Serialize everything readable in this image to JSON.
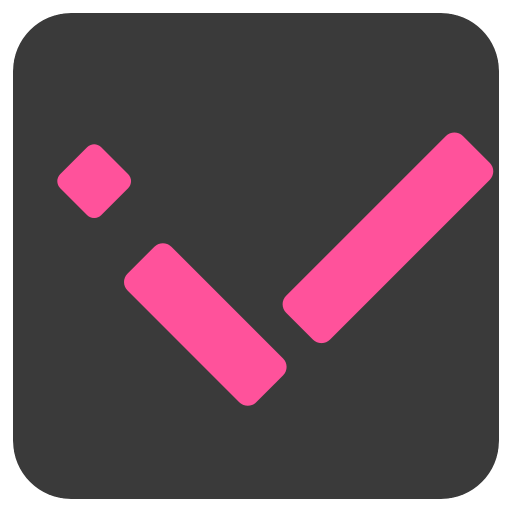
{
  "app_icon": {
    "icon": "checkmark-icon",
    "colors": {
      "background": "#3a3a3a",
      "accent": "#ff529b"
    }
  }
}
